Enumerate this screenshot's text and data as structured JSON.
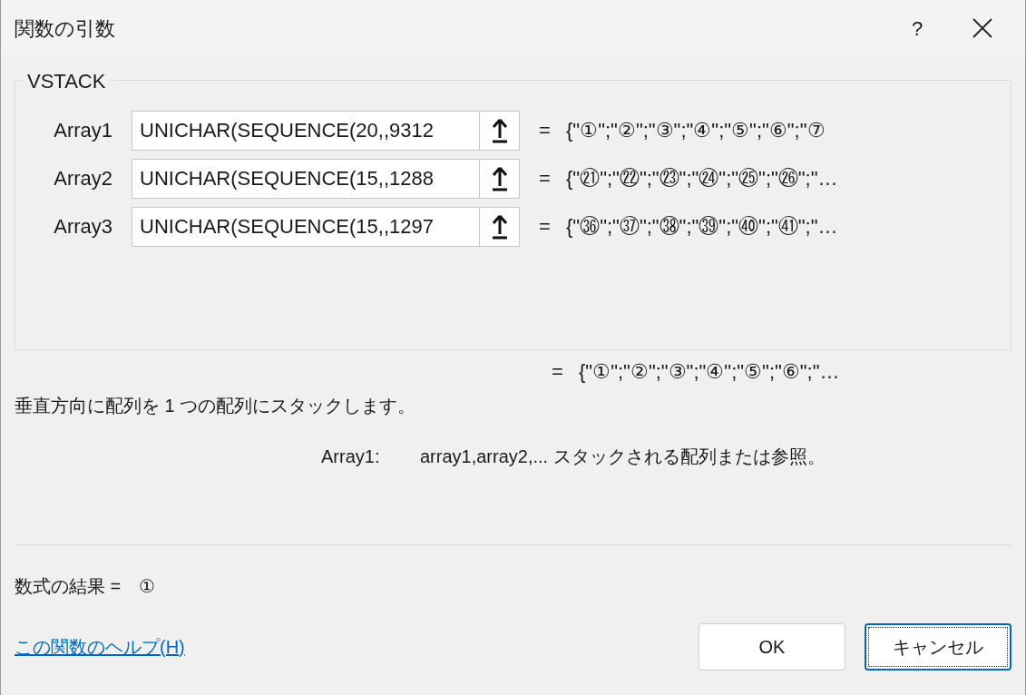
{
  "window": {
    "title": "関数の引数",
    "help_button": "?"
  },
  "function_name": "VSTACK",
  "arguments": [
    {
      "label": "Array1",
      "value": "UNICHAR(SEQUENCE(20,,9312",
      "equals": "=",
      "result": "{\"①\";\"②\";\"③\";\"④\";\"⑤\";\"⑥\";\"⑦"
    },
    {
      "label": "Array2",
      "value": "UNICHAR(SEQUENCE(15,,1288",
      "equals": "=",
      "result": "{\"㉑\";\"㉒\";\"㉓\";\"㉔\";\"㉕\";\"㉖\";\"…"
    },
    {
      "label": "Array3",
      "value": "UNICHAR(SEQUENCE(15,,1297",
      "equals": "=",
      "result": "{\"㊱\";\"㊲\";\"㊳\";\"㊴\";\"㊵\";\"㊶\";\"…"
    }
  ],
  "overall_equals": "=",
  "overall_result": "{\"①\";\"②\";\"③\";\"④\";\"⑤\";\"⑥\";\"…",
  "description": "垂直方向に配列を 1 つの配列にスタックします。",
  "argument_help": {
    "name": "Array1:",
    "text": "array1,array2,... スタックされる配列または参照。"
  },
  "formula_result": {
    "label": "数式の結果 =",
    "value": "①"
  },
  "help_link": "この関数のヘルプ(H)",
  "buttons": [
    {
      "label": "OK",
      "focused": false
    },
    {
      "label": "キャンセル",
      "focused": true
    }
  ]
}
